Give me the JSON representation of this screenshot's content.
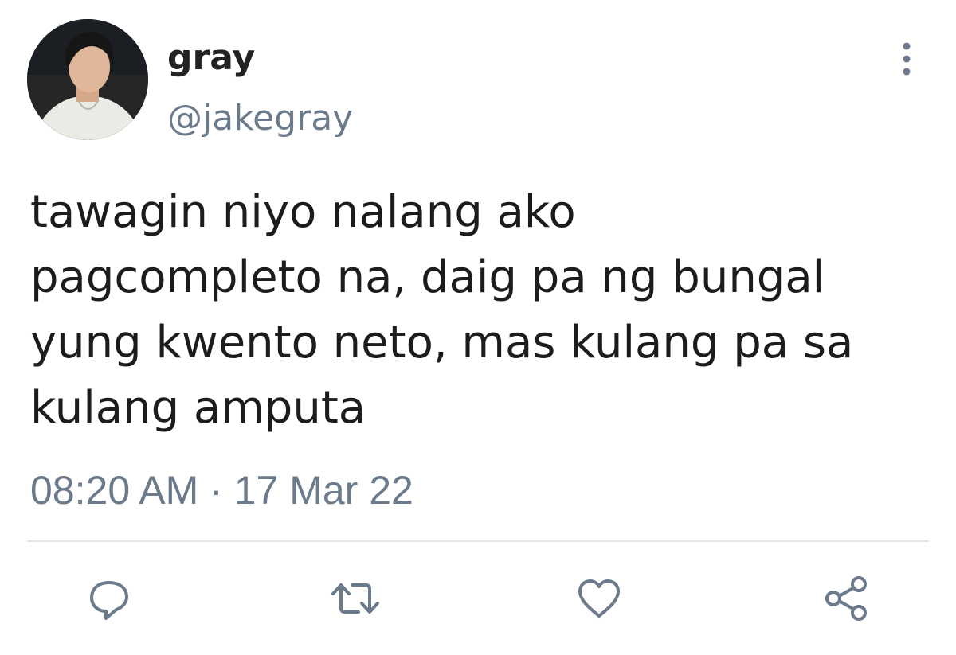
{
  "tweet": {
    "display_name": "gray",
    "handle": "@jakegray",
    "text_lines": [
      "tawagin niyo nalang ako",
      "pagcompleto na, daig pa ng bungal",
      "yung kwento neto, mas kulang pa sa",
      "kulang amputa"
    ],
    "timestamp": "08:20 AM · 17 Mar 22"
  },
  "icons": {
    "avatar": "profile-photo",
    "more": "more-vertical-icon",
    "reply": "reply-icon",
    "retweet": "retweet-icon",
    "like": "heart-icon",
    "share": "share-icon"
  },
  "colors": {
    "text": "#1c1c1c",
    "secondary": "#6b7b8c",
    "icon": "#6b7b8c",
    "divider": "#e3e6e9",
    "background": "#ffffff"
  }
}
